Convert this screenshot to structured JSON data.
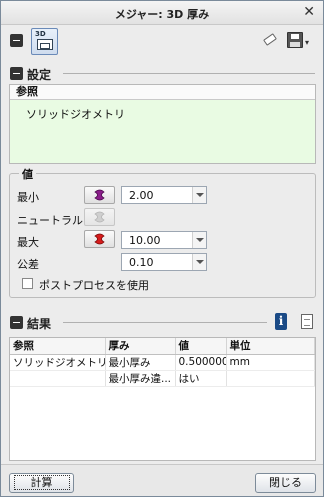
{
  "window": {
    "title": "メジャー: 3D 厚み",
    "close_glyph": "✕"
  },
  "toolbar": {
    "threed_label": "3D",
    "save_dropdown": "▾"
  },
  "settings": {
    "section_title": "設定",
    "reference_header": "参照",
    "reference_item": "ソリッドジオメトリ",
    "value_group_title": "値",
    "min_label": "最小",
    "min_value": "2.00",
    "neutral_label": "ニュートラル",
    "max_label": "最大",
    "max_value": "10.00",
    "tolerance_label": "公差",
    "tolerance_value": "0.10",
    "postprocess_label": "ポストプロセスを使用",
    "colors": {
      "min": "#8a1e8a",
      "neutral": "#b8b8b8",
      "max": "#d61c1c",
      "ref_bg": "#e9fbe3"
    }
  },
  "results": {
    "section_title": "結果",
    "columns": [
      "参照",
      "厚み",
      "値",
      "単位"
    ],
    "rows": [
      [
        "ソリッドジオメトリ",
        "最小厚み",
        "0.500000",
        "mm"
      ],
      [
        "",
        "最小厚み違...",
        "はい",
        ""
      ]
    ]
  },
  "footer": {
    "compute_label": "計算",
    "close_label": "閉じる"
  }
}
